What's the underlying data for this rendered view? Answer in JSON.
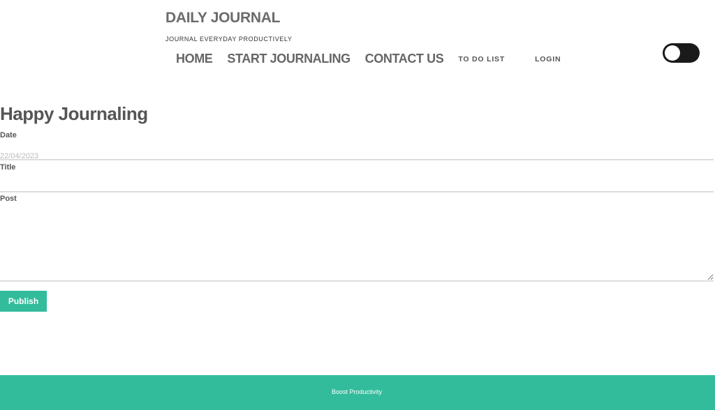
{
  "header": {
    "title": "DAILY JOURNAL",
    "tagline": "JOURNAL EVERYDAY PRODUCTIVELY"
  },
  "nav": {
    "home": "HOME",
    "start": "START JOURNALING",
    "contact": "CONTACT US",
    "todo": "TO DO LIST",
    "login": "LOGIN"
  },
  "theme_toggle": {
    "icon": "theme-toggle-switch",
    "state": "off"
  },
  "form": {
    "heading": "Happy Journaling",
    "date_label": "Date",
    "date_value": "22/04/2023",
    "title_label": "Title",
    "title_value": "",
    "post_label": "Post",
    "post_value": "",
    "publish_label": "Publish"
  },
  "footer": {
    "text": "Boost Productivity"
  },
  "colors": {
    "accent": "#32bc9b",
    "toggle": "#1a1a1a",
    "text": "#555555"
  }
}
